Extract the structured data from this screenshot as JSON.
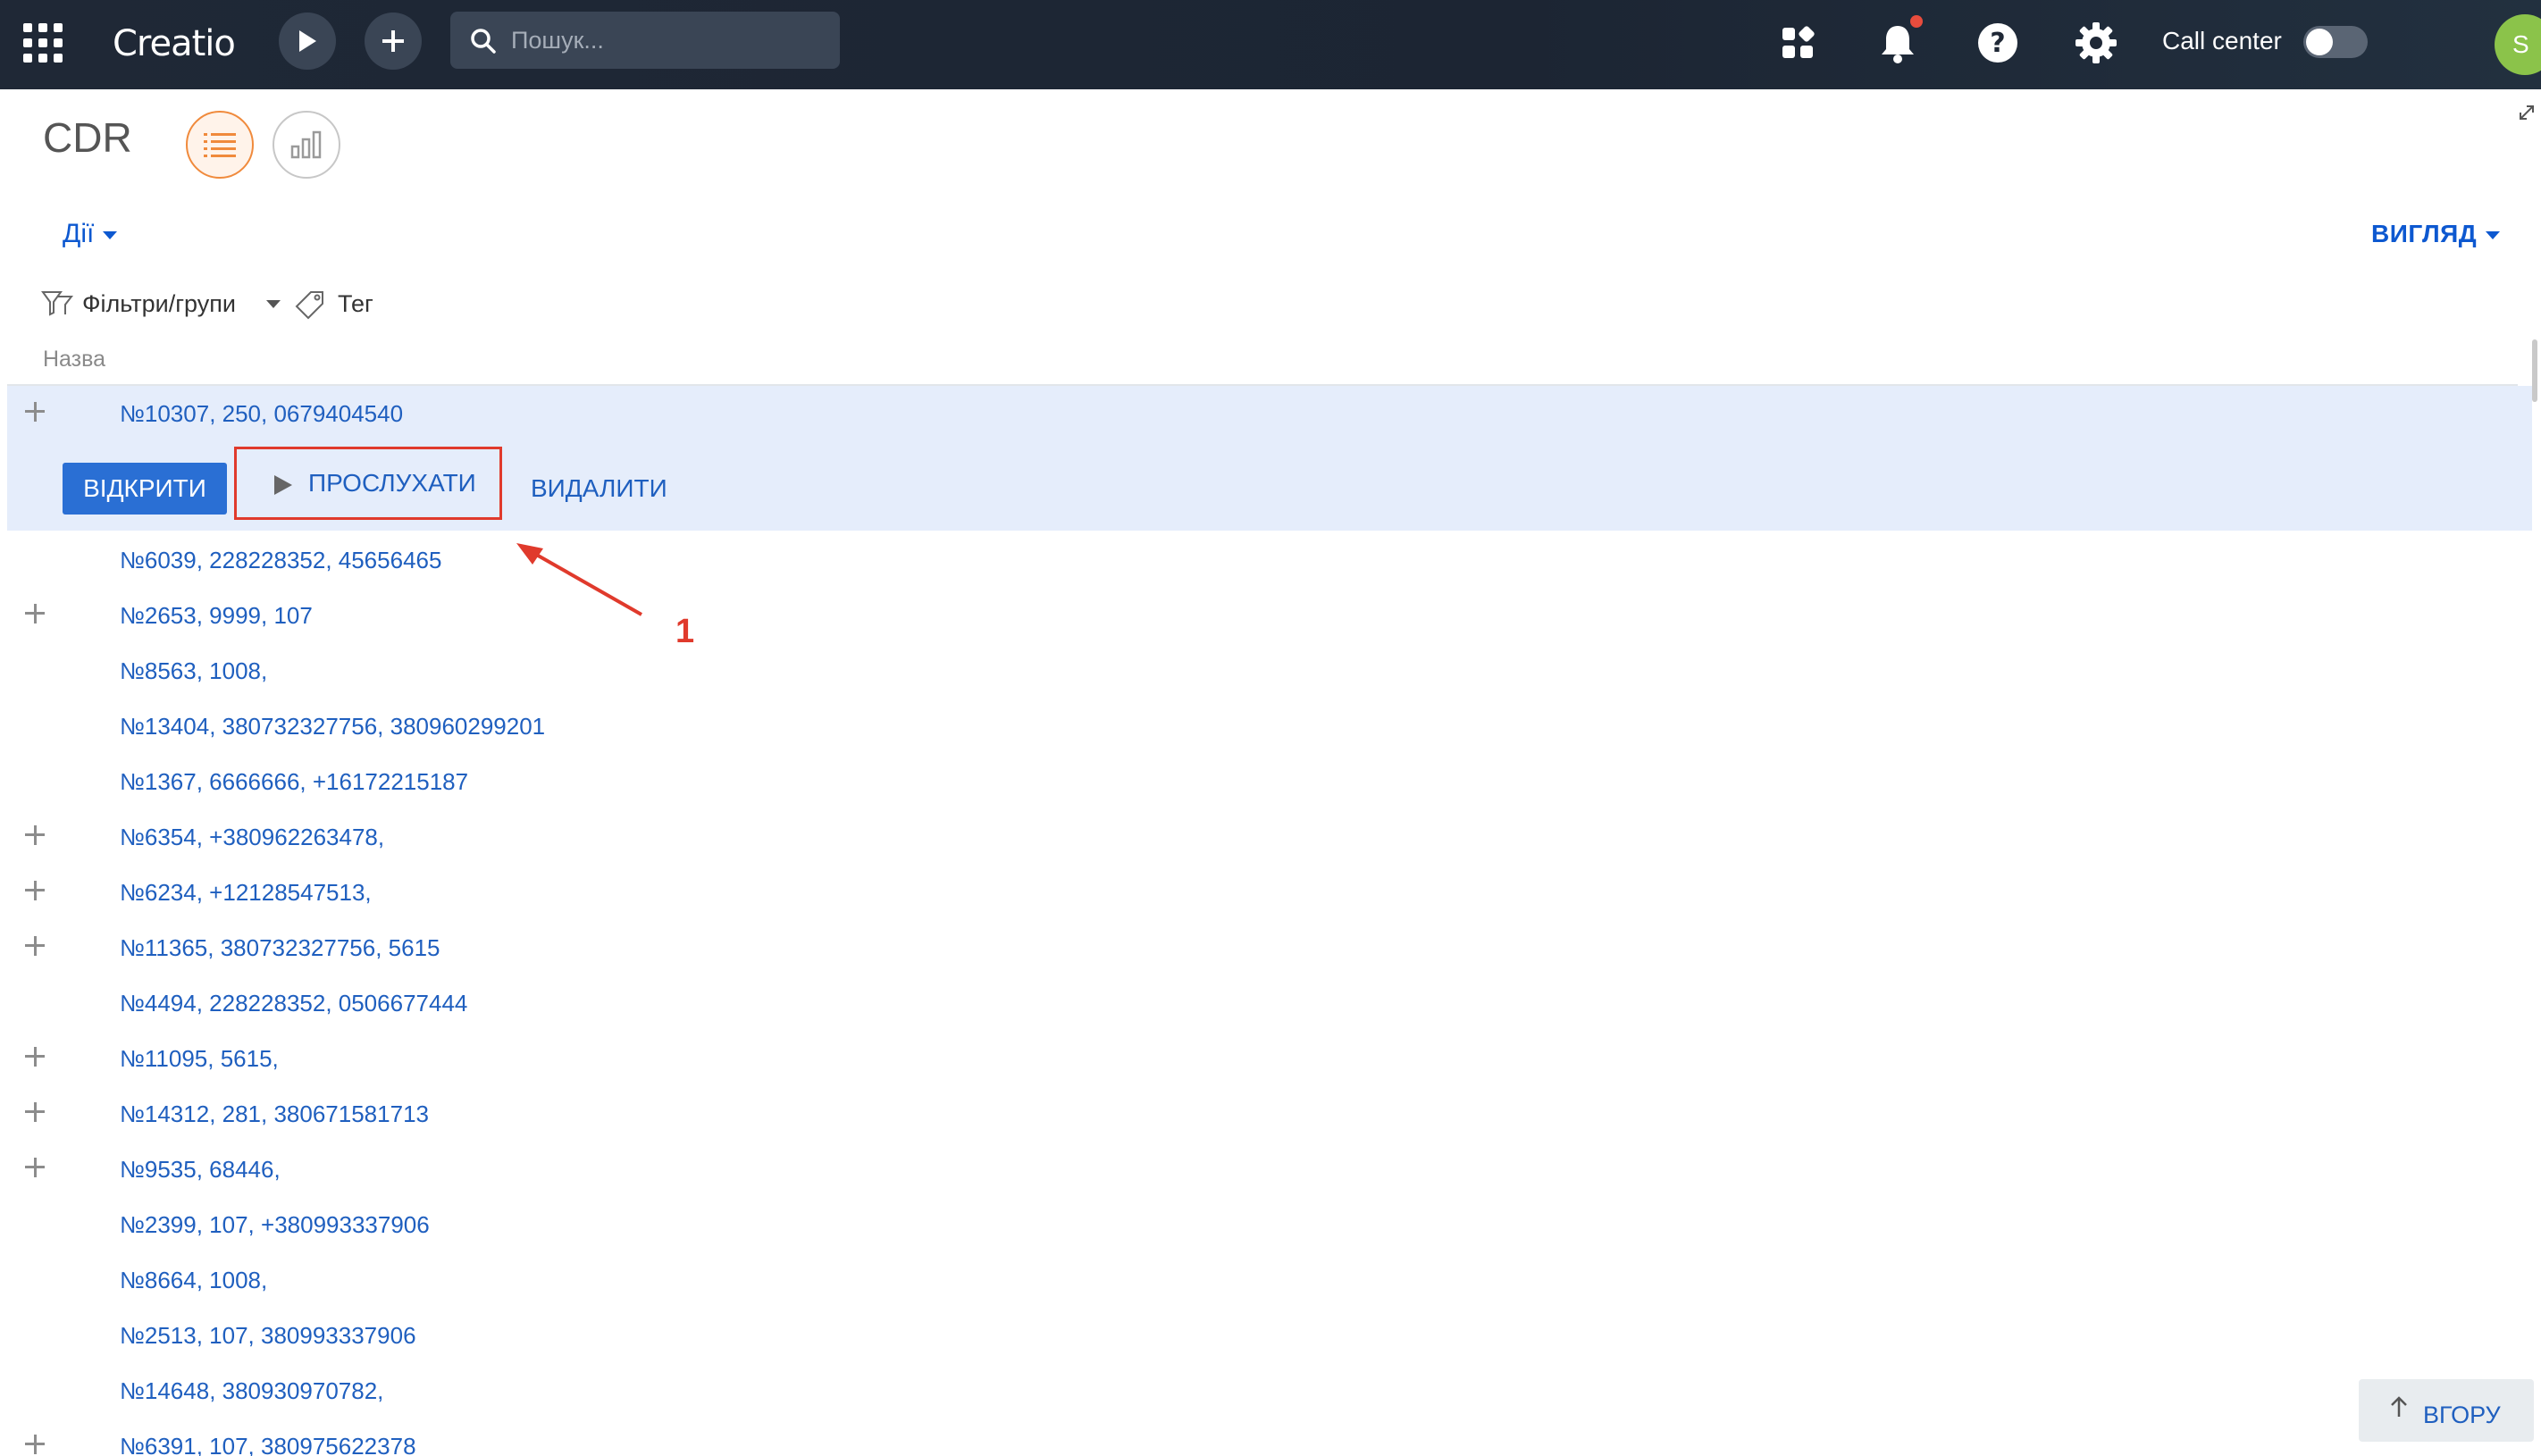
{
  "topbar": {
    "logo": "Creatio",
    "search_placeholder": "Пошук...",
    "call_center_label": "Call center",
    "avatar_initial": "S"
  },
  "page": {
    "title": "CDR"
  },
  "toolbar": {
    "actions_label": "Дії",
    "view_label": "ВИГЛЯД",
    "filters_label": "Фільтри/групи",
    "tag_label": "Тег"
  },
  "grid": {
    "column_header": "Назва",
    "selected_row": "№10307, 250, 0679404540",
    "row_actions": {
      "open": "ВІДКРИТИ",
      "listen": "ПРОСЛУХАТИ",
      "delete": "ВИДАЛИТИ"
    },
    "rows": [
      "№6039, 228228352, 45656465",
      "№2653, 9999, 107",
      "№8563, 1008,",
      "№13404, 380732327756, 380960299201",
      "№1367, 6666666, +16172215187",
      "№6354, +380962263478,",
      "№6234, +12128547513,",
      "№11365, 380732327756, 5615",
      "№4494, 228228352, 0506677444",
      "№11095, 5615,",
      "№14312, 281, 380671581713",
      "№9535, 68446,",
      "№2399, 107, +380993337906",
      "№8664, 1008,",
      "№2513, 107, 380993337906",
      "№14648, 380930970782,",
      "№6391, 107, 380975622378"
    ]
  },
  "annotation": {
    "number": "1",
    "color": "#e03a2c"
  },
  "scroll_top_label": "ВГОРУ",
  "colors": {
    "accent": "#2a6fd4",
    "link": "#1f5fbf",
    "selected_row": "#e5edfb",
    "active_view": "#f08a3c"
  }
}
